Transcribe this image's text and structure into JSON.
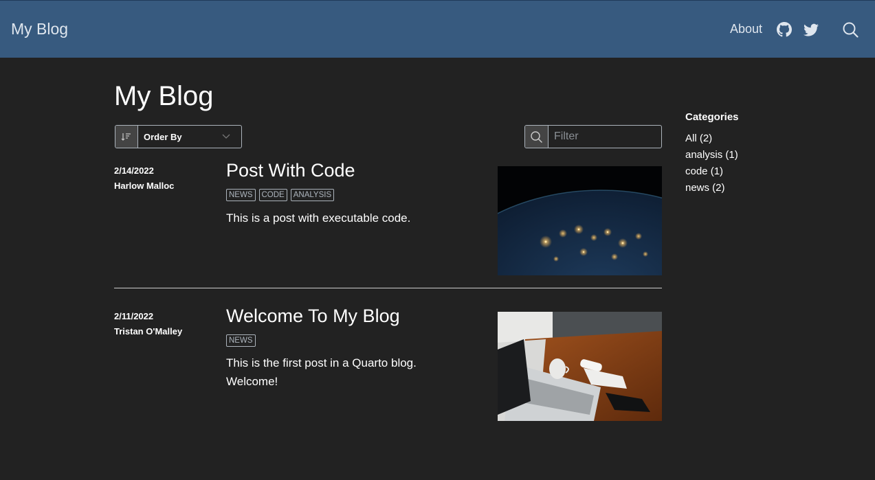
{
  "navbar": {
    "brand": "My Blog",
    "about": "About",
    "icons": [
      "github-icon",
      "twitter-icon",
      "search-icon"
    ]
  },
  "page": {
    "title": "My Blog"
  },
  "listing_controls": {
    "order_by": "Order By",
    "filter_placeholder": "Filter"
  },
  "posts": [
    {
      "date": "2/14/2022",
      "author": "Harlow Malloc",
      "title": "Post With Code",
      "categories": [
        "NEWS",
        "CODE",
        "ANALYSIS"
      ],
      "description": "This is a post with executable code."
    },
    {
      "date": "2/11/2022",
      "author": "Tristan O'Malley",
      "title": "Welcome To My Blog",
      "categories": [
        "NEWS"
      ],
      "description": "This is the first post in a Quarto blog. Welcome!"
    }
  ],
  "sidebar": {
    "title": "Categories",
    "items": [
      "All (2)",
      "analysis (1)",
      "code (1)",
      "news (2)"
    ]
  },
  "colors": {
    "navbar_bg": "#375a7f",
    "page_bg": "#222222",
    "text": "#ffffff",
    "muted": "#adb5bd"
  }
}
